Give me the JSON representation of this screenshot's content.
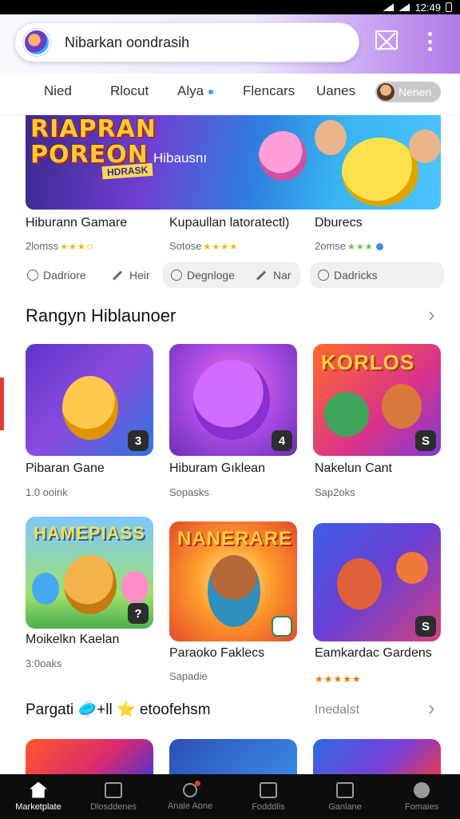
{
  "status": {
    "time": "12:49"
  },
  "header": {
    "search_text": "Nibarkan oondrasih",
    "logo_icon": "app-mascot-icon",
    "mail_icon": "mail-icon",
    "more_icon": "more-vertical-icon"
  },
  "tabs": [
    {
      "label": "Nied"
    },
    {
      "label": "Rlocut"
    },
    {
      "label": "Alya"
    },
    {
      "label": "Flencars"
    },
    {
      "label": "Uanes"
    },
    {
      "label": "Nenen"
    }
  ],
  "banner": {
    "logo_line1": "RIAPRAN",
    "logo_line2": "POREON",
    "logo_sub": "HDRASK",
    "caption": "Hibausnı"
  },
  "top_games": [
    {
      "title": "Hiburann Gamare",
      "meta": "2lomss",
      "action_1": "Dadriore",
      "action_2": "Heir"
    },
    {
      "title": "Kupaullan latoratectl)",
      "meta": "Sotose",
      "action_1": "Degnloge",
      "action_2": "Nar"
    },
    {
      "title": "Dburecs",
      "meta": "2omse",
      "action_1": "Dadricks"
    }
  ],
  "section_1": {
    "title": "Rangyn Hiblaunoer"
  },
  "grid_row_1": [
    {
      "title": "Pibaran Gane",
      "meta": "1.0 ooink",
      "badge": "3",
      "logo": ""
    },
    {
      "title": "Hiburam Gıklean",
      "meta": "Sopasks",
      "badge": "4",
      "logo": ""
    },
    {
      "title": "Nakelun Cant",
      "meta": "Sap2oks",
      "badge": "S",
      "logo": "KORLOS"
    }
  ],
  "grid_row_2": [
    {
      "title": "Moikelkn Kaelan",
      "meta": "3:0oaks",
      "badge": "?",
      "logo": "HAMEPIASS"
    },
    {
      "title": "Paraoko Faklecs",
      "meta": "Sapadie",
      "badge": "",
      "logo": "NANERARE"
    },
    {
      "title": "Eamkardac Gardens",
      "meta": "",
      "badge": "S",
      "logo": ""
    }
  ],
  "section_2": {
    "title": "Pargati 🥏+ll ⭐ etoofehsm",
    "link": "Inedalst"
  },
  "bottom_nav": [
    {
      "label": "Marketplate",
      "icon": "home-icon",
      "active": true
    },
    {
      "label": "Dlosddenes",
      "icon": "library-icon",
      "active": false
    },
    {
      "label": "Anale Aone",
      "icon": "search-icon",
      "active": false
    },
    {
      "label": "Fodddlis",
      "icon": "inbox-icon",
      "active": false
    },
    {
      "label": "Ganlane",
      "icon": "store-icon",
      "active": false
    },
    {
      "label": "Fomaies",
      "icon": "user-icon",
      "active": false
    }
  ],
  "colors": {
    "accent": "#a86ce6",
    "star": "#f5b400",
    "scroll_marker": "#e53935"
  }
}
